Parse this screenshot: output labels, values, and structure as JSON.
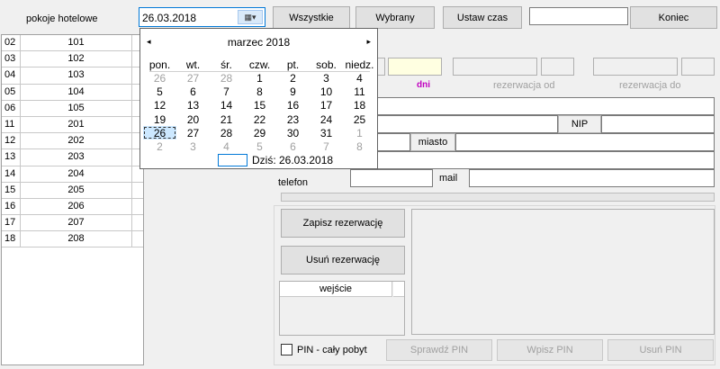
{
  "header": {
    "rooms_label": "pokoje hotelowe",
    "date_value": "26.03.2018",
    "btn_all": "Wszystkie",
    "btn_selected": "Wybrany",
    "btn_set_time": "Ustaw czas",
    "search_value": "",
    "btn_end": "Koniec"
  },
  "rooms": [
    {
      "floor": "02",
      "room": "101"
    },
    {
      "floor": "03",
      "room": "102"
    },
    {
      "floor": "04",
      "room": "103"
    },
    {
      "floor": "05",
      "room": "104"
    },
    {
      "floor": "06",
      "room": "105"
    },
    {
      "floor": "11",
      "room": "201"
    },
    {
      "floor": "12",
      "room": "202"
    },
    {
      "floor": "13",
      "room": "203"
    },
    {
      "floor": "14",
      "room": "204"
    },
    {
      "floor": "15",
      "room": "205"
    },
    {
      "floor": "16",
      "room": "206"
    },
    {
      "floor": "17",
      "room": "207"
    },
    {
      "floor": "18",
      "room": "208"
    }
  ],
  "calendar": {
    "month": "marzec 2018",
    "prev": "◂",
    "next": "▸",
    "weekdays": [
      "pon.",
      "wt.",
      "śr.",
      "czw.",
      "pt.",
      "sob.",
      "niedz."
    ],
    "weeks": [
      [
        [
          "26",
          1
        ],
        [
          "27",
          1
        ],
        [
          "28",
          1
        ],
        [
          "1",
          0
        ],
        [
          "2",
          0
        ],
        [
          "3",
          0
        ],
        [
          "4",
          0
        ]
      ],
      [
        [
          "5",
          0
        ],
        [
          "6",
          0
        ],
        [
          "7",
          0
        ],
        [
          "8",
          0
        ],
        [
          "9",
          0
        ],
        [
          "10",
          0
        ],
        [
          "11",
          0
        ]
      ],
      [
        [
          "12",
          0
        ],
        [
          "13",
          0
        ],
        [
          "14",
          0
        ],
        [
          "15",
          0
        ],
        [
          "16",
          0
        ],
        [
          "17",
          0
        ],
        [
          "18",
          0
        ]
      ],
      [
        [
          "19",
          0
        ],
        [
          "20",
          0
        ],
        [
          "21",
          0
        ],
        [
          "22",
          0
        ],
        [
          "23",
          0
        ],
        [
          "24",
          0
        ],
        [
          "25",
          0
        ]
      ],
      [
        [
          "26",
          2
        ],
        [
          "27",
          0
        ],
        [
          "28",
          0
        ],
        [
          "29",
          0
        ],
        [
          "30",
          0
        ],
        [
          "31",
          0
        ],
        [
          "1",
          1
        ]
      ],
      [
        [
          "2",
          1
        ],
        [
          "3",
          1
        ],
        [
          "4",
          1
        ],
        [
          "5",
          1
        ],
        [
          "6",
          1
        ],
        [
          "7",
          1
        ],
        [
          "8",
          1
        ]
      ]
    ],
    "today": "Dziś: 26.03.2018"
  },
  "form": {
    "dni": "dni",
    "res_from": "rezerwacja od",
    "res_to": "rezerwacja do",
    "nip": "NIP",
    "city": "miasto",
    "phone": "telefon",
    "mail": "mail",
    "btn_save": "Zapisz rezerwację",
    "btn_delete": "Usuń rezerwację",
    "entry_col": "wejście",
    "pin_checkbox": "PIN - cały pobyt",
    "btn_check_pin": "Sprawdź PIN",
    "btn_enter_pin": "Wpisz PIN",
    "btn_delete_pin": "Usuń PIN"
  },
  "colors": {
    "dni_label": "#c000c0",
    "accent": "#0078d7",
    "highlight_field": "#ffffe1"
  }
}
